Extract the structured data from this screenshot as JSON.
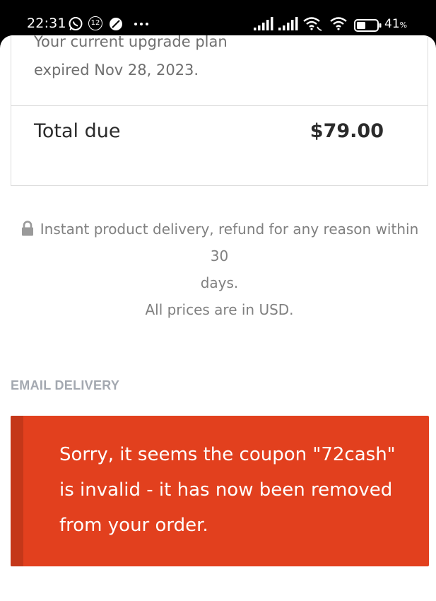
{
  "status_bar": {
    "time": "22:31",
    "notification_count": "12",
    "battery_percent": "41",
    "battery_unit": "%",
    "icons": [
      "whatsapp-icon",
      "notification-count-icon",
      "app-icon",
      "more-dots-icon",
      "signal-1-icon",
      "signal-2-icon",
      "wifi-calling-icon",
      "wifi-icon",
      "battery-icon"
    ]
  },
  "order_summary": {
    "plan_note_line1": "Your current upgrade plan",
    "plan_note_line2": "expired Nov 28, 2023.",
    "total_label": "Total due",
    "total_value": "$79.00"
  },
  "secure_note": {
    "icon": "lock-icon",
    "line1": "Instant product delivery, refund for any reason within 30",
    "line2": "days.",
    "line3": "All prices are in USD."
  },
  "email_delivery": {
    "title": "EMAIL DELIVERY"
  },
  "error_notice": {
    "message": "Sorry, it seems the coupon \"72cash\" is invalid - it has now been removed from your order.",
    "color": "#e2401e"
  }
}
